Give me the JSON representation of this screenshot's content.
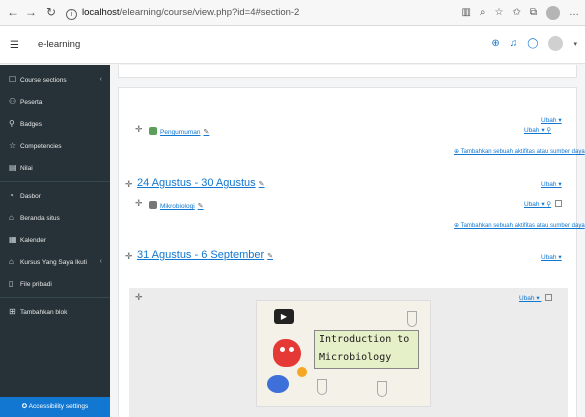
{
  "browser": {
    "url_host": "localhost",
    "url_path": "/elearning/course/view.php?id=4#section-2"
  },
  "navbar": {
    "brand": "e-learning"
  },
  "drawer": {
    "items": [
      {
        "label": "Course sections",
        "icon": "square-icon",
        "has_chevron": true
      },
      {
        "label": "Peserta",
        "icon": "users-icon"
      },
      {
        "label": "Badges",
        "icon": "badge-icon"
      },
      {
        "label": "Competencies",
        "icon": "star-icon"
      },
      {
        "label": "Nilai",
        "icon": "table-icon"
      },
      {
        "label": "Dasbor",
        "icon": "dashboard-icon"
      },
      {
        "label": "Beranda situs",
        "icon": "home-icon"
      },
      {
        "label": "Kalender",
        "icon": "calendar-icon"
      },
      {
        "label": "Kursus Yang Saya Ikuti",
        "icon": "graduation-cap-icon",
        "has_chevron": true
      },
      {
        "label": "File pribadi",
        "icon": "file-icon"
      },
      {
        "label": "Tambahkan blok",
        "icon": "plus-square-icon"
      }
    ],
    "accessibility": "Accessibility settings"
  },
  "content": {
    "section1": {
      "edit_label": "Ubah",
      "activity_edit_label": "Ubah",
      "activity_name": "Pengumuman",
      "add_link": "Tambahkan sebuah aktifitas atau sumber daya"
    },
    "section2": {
      "title": "24 Agustus - 30 Agustus",
      "edit_label": "Ubah",
      "activity_edit_label": "Ubah",
      "activity_name": "Mikrobiologi",
      "add_link": "Tambahkan sebuah aktifitas atau sumber daya"
    },
    "section3": {
      "title": "31 Agustus - 6 September",
      "edit_label": "Ubah",
      "activity_edit_label": "Ubah",
      "video_title_line1": "Introduction to",
      "video_title_line2": "Microbiology"
    }
  },
  "colors": {
    "drawer_bg": "#263238",
    "accent": "#1177d1"
  }
}
